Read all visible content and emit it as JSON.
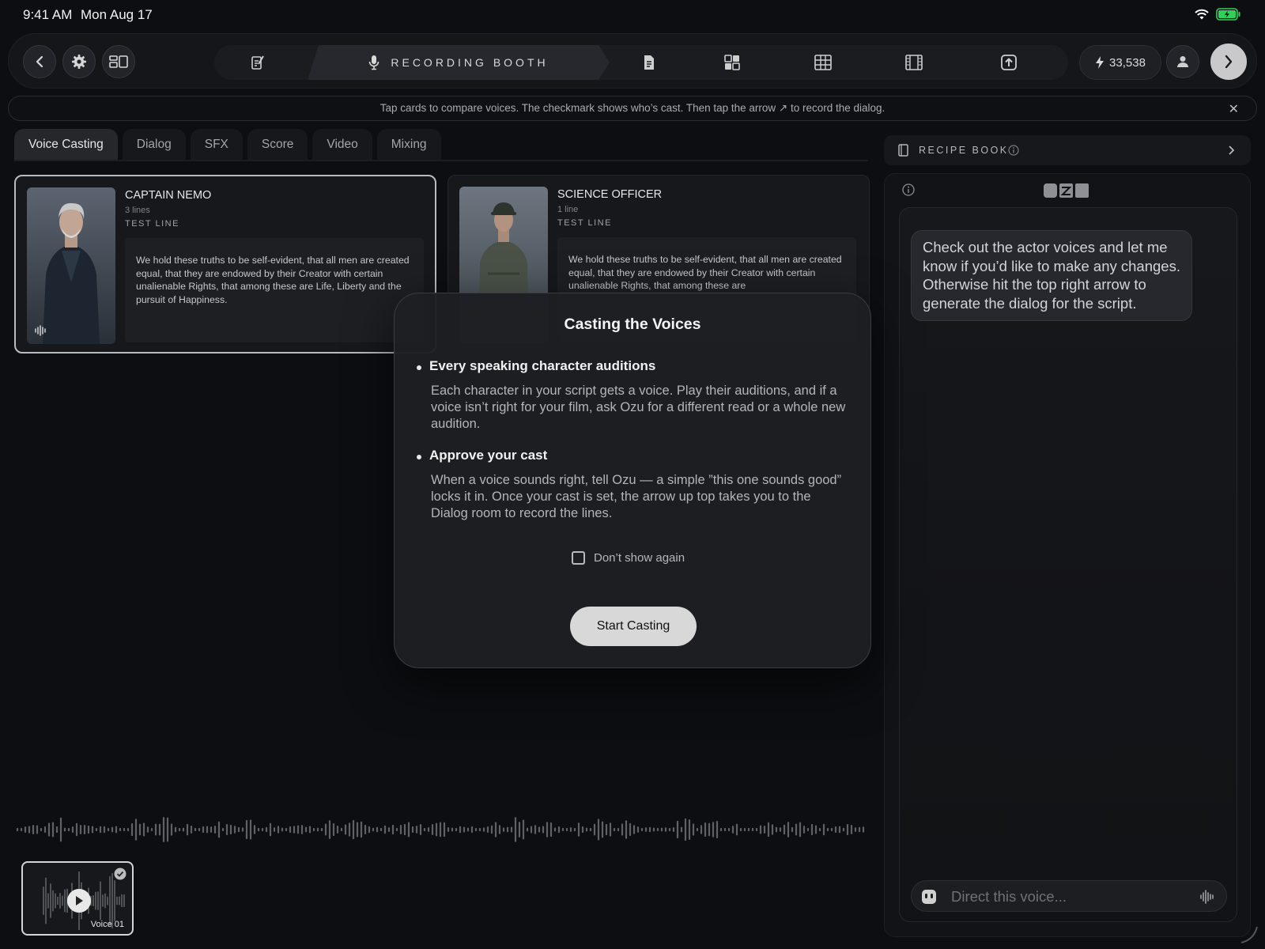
{
  "status": {
    "time": "9:41 AM",
    "date": "Mon Aug 17"
  },
  "toolbar": {
    "active_stage": "RECORDING BOOTH",
    "credits": "33,538"
  },
  "hint": {
    "text": "Tap cards to compare voices. The checkmark shows who’s cast. Then tap the arrow ↗ to record the dialog."
  },
  "tabs": [
    {
      "label": "Voice Casting",
      "active": true
    },
    {
      "label": "Dialog"
    },
    {
      "label": "SFX"
    },
    {
      "label": "Score"
    },
    {
      "label": "Video"
    },
    {
      "label": "Mixing"
    }
  ],
  "cards": [
    {
      "name": "CAPTAIN NEMO",
      "lines": "3 lines",
      "test_label": "TEST LINE",
      "quote": "We hold these truths to be self-evident, that all men are created equal, that they are endowed by their Creator with certain unalienable Rights, that among these are Life, Liberty and the pursuit of Happiness.",
      "selected": true
    },
    {
      "name": "SCIENCE OFFICER",
      "lines": "1 line",
      "test_label": "TEST LINE",
      "quote": "We hold these truths to be self-evident, that all men are created equal, that they are endowed by their Creator with certain unalienable Rights, that among these are",
      "selected": false
    }
  ],
  "voice_thumb": {
    "label": "Voice 01"
  },
  "recipe": {
    "label": "RECIPE BOOK"
  },
  "chat": {
    "logo": "OZU",
    "message": "Check out the actor voices and let me know if you’d like to make any changes. Otherwise hit the top right arrow to generate the dialog for the script.",
    "input_placeholder": "Direct this voice..."
  },
  "modal": {
    "title": "Casting the Voices",
    "items": [
      {
        "heading": "Every speaking character auditions",
        "body": "Each character in your script gets a voice. Play their auditions, and if a voice isn’t right for your film, ask Ozu for a different read or a whole new audition."
      },
      {
        "heading": "Approve your cast",
        "body": "When a voice sounds right, tell Ozu — a simple ”this one sounds good” locks it in. Once your cast is set, the arrow up top takes you to the Dialog room to record the lines."
      }
    ],
    "dont_show": "Don’t show again",
    "start_button": "Start Casting"
  },
  "colors": {
    "background": "#0d0e11",
    "accent_battery": "#30d158"
  }
}
